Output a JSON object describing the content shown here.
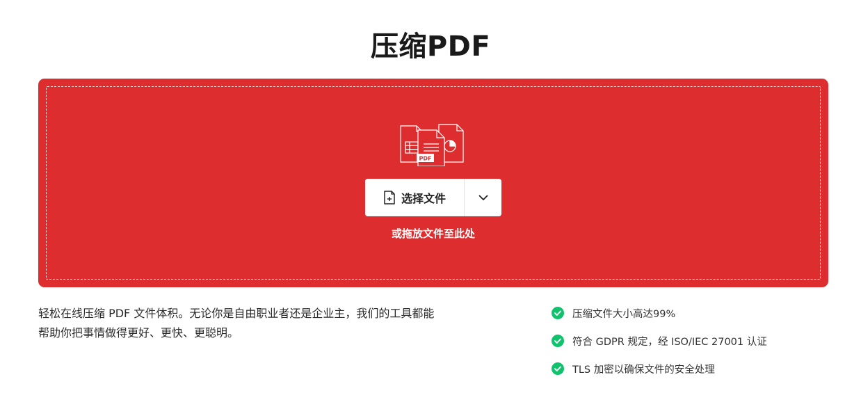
{
  "header": {
    "title": "压缩PDF"
  },
  "upload": {
    "select_label": "选择文件",
    "drop_hint": "或拖放文件至此处",
    "pdf_badge": "PDF"
  },
  "description": {
    "line1": "轻松在线压缩 PDF 文件体积。无论你是自由职业者还是企业主，我们的工具都能",
    "line2": "帮助你把事情做得更好、更快、更聪明。"
  },
  "features": [
    {
      "label": "压缩文件大小高达99%"
    },
    {
      "label": "符合 GDPR 规定，经 ISO/IEC 27001 认证"
    },
    {
      "label": "TLS 加密以确保文件的安全处理"
    }
  ],
  "colors": {
    "accent_red": "#dd2d2f",
    "check_green": "#11c26d"
  }
}
